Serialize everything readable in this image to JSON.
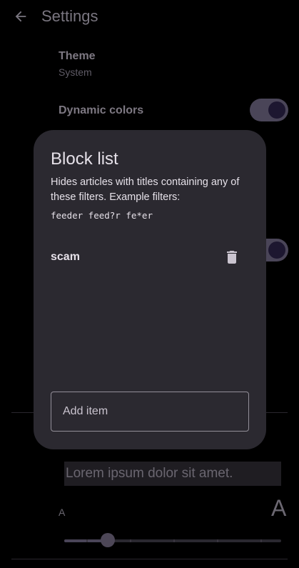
{
  "header": {
    "title": "Settings",
    "back_icon": "arrow-back-icon"
  },
  "settings": {
    "theme": {
      "title": "Theme",
      "value": "System"
    },
    "dynamic_colors": {
      "title": "Dynamic colors",
      "enabled": true
    }
  },
  "reader": {
    "preview_text": "Lorem ipsum dolor sit amet.",
    "font_small_label": "A",
    "font_large_label": "A",
    "font_size_level": 0.2
  },
  "dialog": {
    "title": "Block list",
    "description": "Hides articles with titles containing any of these filters. Example filters:",
    "example": "feeder feed?r fe*er",
    "items": [
      {
        "label": "scam"
      }
    ],
    "delete_icon": "trash-icon",
    "add_placeholder": "Add item"
  },
  "colors": {
    "accent": "#4a4558",
    "dialog_surface": "#2b2930",
    "on_surface": "#e6e1e9"
  }
}
